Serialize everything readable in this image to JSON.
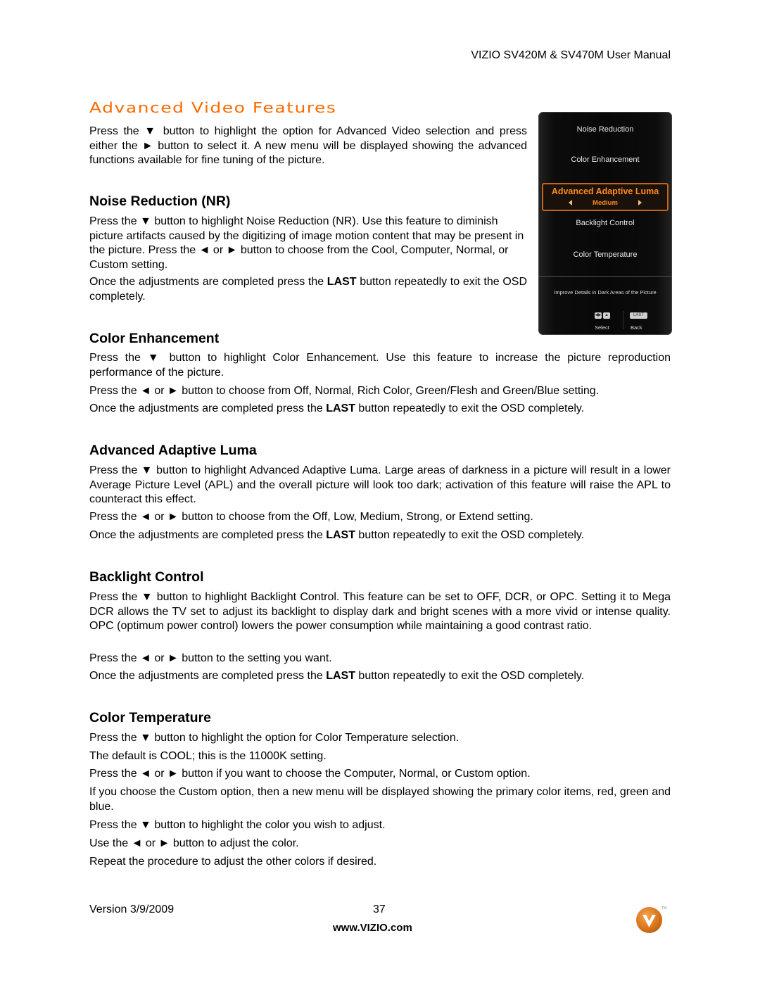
{
  "header": {
    "title": "VIZIO SV420M & SV470M User Manual"
  },
  "page_title": "Advanced Video Features",
  "intro": "Press the ▼ button to highlight the option for Advanced Video selection and press either the ► button to select it.  A new menu will be displayed showing the advanced functions available for fine tuning of the picture.",
  "sections": {
    "noise_reduction": {
      "heading": "Noise Reduction (NR)",
      "p1": "Press the ▼ button to highlight Noise Reduction (NR).  Use this feature to diminish picture artifacts caused by the digitizing of image motion content that may be present in the picture.  Press the ◄ or ► button to choose from the Cool, Computer, Normal, or Custom setting.",
      "p2_pre": "Once the adjustments are completed press the ",
      "p2_bold": "LAST",
      "p2_post": " button repeatedly to exit the OSD completely."
    },
    "color_enhancement": {
      "heading": "Color Enhancement",
      "p1": "Press the ▼ button to highlight Color Enhancement. Use this feature to increase the picture reproduction performance of the picture.",
      "p2": "Press the ◄ or ► button to choose from Off, Normal, Rich Color, Green/Flesh and Green/Blue setting.",
      "p3_pre": "Once the adjustments are completed press the ",
      "p3_bold": "LAST",
      "p3_post": " button repeatedly to exit the OSD completely."
    },
    "adaptive_luma": {
      "heading": "Advanced Adaptive Luma",
      "p1": "Press the ▼ button to highlight Advanced Adaptive Luma. Large areas of darkness in a picture will result in a lower Average Picture Level (APL) and the overall picture will look too dark; activation of this feature will raise the APL to counteract this effect.",
      "p2": "Press the ◄ or ► button to choose from the Off, Low, Medium, Strong, or Extend setting.",
      "p3_pre": "Once the adjustments are completed press the ",
      "p3_bold": "LAST",
      "p3_post": " button repeatedly to exit the OSD completely."
    },
    "backlight": {
      "heading": "Backlight Control",
      "p1": "Press the ▼ button to highlight Backlight Control. This feature can be set to OFF, DCR, or OPC. Setting it to Mega DCR allows the TV set to adjust its backlight to display dark and bright scenes with a more vivid or intense quality. OPC (optimum power control) lowers the power consumption while maintaining a good contrast ratio.",
      "p2": "Press the ◄ or ► button to the setting you want.",
      "p3_pre": "Once the adjustments are completed press the ",
      "p3_bold": "LAST",
      "p3_post": " button repeatedly to exit the OSD completely."
    },
    "color_temperature": {
      "heading": "Color Temperature",
      "p1": "Press the ▼ button to highlight the option for Color Temperature selection.",
      "p2": "The default is COOL; this is the 11000K setting.",
      "p3": "Press the ◄ or ► button if you want to choose the Computer, Normal, or Custom option.",
      "p4": "If you choose the Custom option, then a new menu will be displayed showing the primary color items, red, green and blue.",
      "p5": "Press the ▼ button to highlight the color you wish to adjust.",
      "p6": "Use the ◄ or ► button to adjust the color.",
      "p7": "Repeat the procedure to adjust the other colors if desired."
    }
  },
  "osd_menu": {
    "items": [
      "Noise Reduction",
      "Color Enhancement",
      "Backlight Control",
      "Color Temperature"
    ],
    "selected_label": "Advanced Adaptive Luma",
    "selected_value": "Medium",
    "help_text": "Improve Details in Dark Areas of the Picture",
    "key_last": "LAST",
    "select_label": "Select",
    "back_label": "Back",
    "accent_color": "#ff8a1e"
  },
  "footer": {
    "version": "Version 3/9/2009",
    "page_number": "37",
    "url": "www.VIZIO.com",
    "logo_tm": "TM"
  },
  "colors": {
    "title": "#ff6a00",
    "text": "#000000"
  }
}
